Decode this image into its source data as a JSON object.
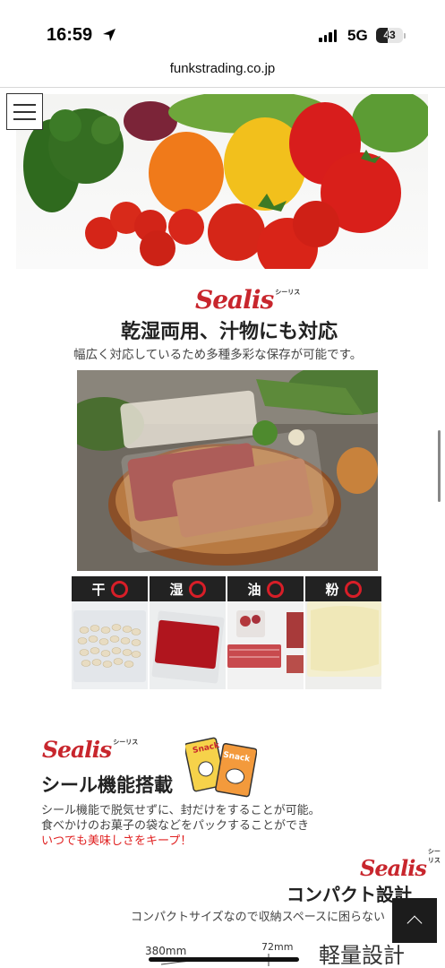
{
  "status": {
    "time": "16:59",
    "network": "5G",
    "battery": "43",
    "battery_level": 0.43
  },
  "browser": {
    "url": "funkstrading.co.jp"
  },
  "menu": {
    "icon": "hamburger-icon"
  },
  "section1": {
    "logo_brand": "Sealis",
    "logo_sub": "シーリス",
    "title": "乾湿両用、汁物にも対応",
    "desc": "幅広く対応しているため多種多彩な保存が可能です。"
  },
  "grid": {
    "items": [
      {
        "label": "干",
        "icon": "circle-icon"
      },
      {
        "label": "湿",
        "icon": "circle-icon"
      },
      {
        "label": "油",
        "icon": "circle-icon"
      },
      {
        "label": "粉",
        "icon": "circle-icon"
      }
    ]
  },
  "section2": {
    "logo_brand": "Sealis",
    "logo_sub": "シーリス",
    "snack_text_1": "Snack",
    "snack_text_2": "Snack",
    "title": "シール機能搭載",
    "line1": "シール機能で脱気せずに、封だけをすることが可能。",
    "line2": "食べかけのお菓子の袋などをパックすることができ",
    "line3_red": "いつでも美味しさをキープ！"
  },
  "section3": {
    "logo_brand": "Sealis",
    "logo_sub": "シーリス",
    "title": "コンパクト設計",
    "desc": "コンパクトサイズなので収納スペースに困らない",
    "dim1": "380mm",
    "dim2": "72mm",
    "title2": "軽量設計"
  },
  "colors": {
    "brand_red": "#c8262d",
    "accent_red": "#e02020",
    "dark": "#222222"
  },
  "back_to_top": {
    "icon": "chevron-up-icon"
  }
}
